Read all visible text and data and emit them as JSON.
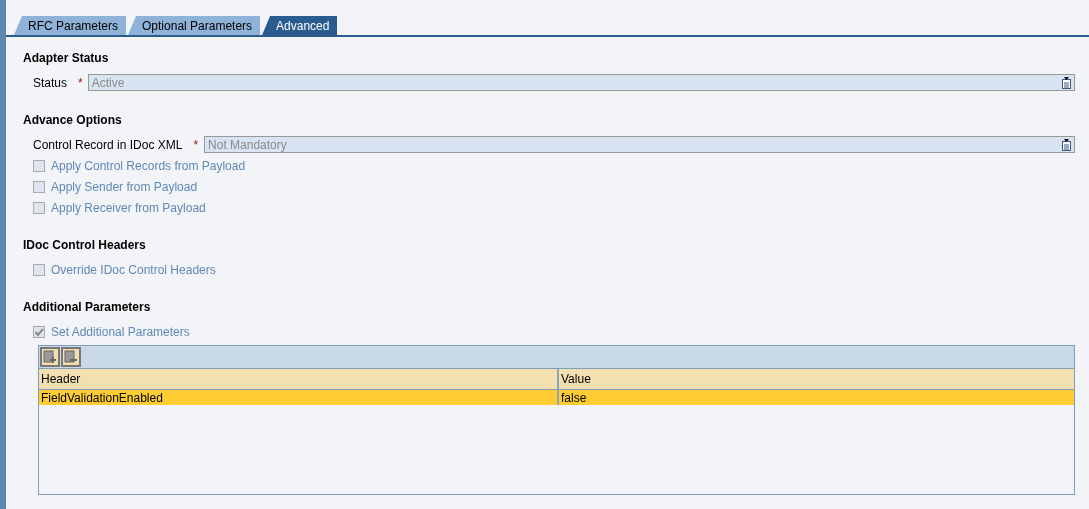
{
  "tabs": [
    {
      "label": "RFC Parameters",
      "selected": false
    },
    {
      "label": "Optional Parameters",
      "selected": false
    },
    {
      "label": "Advanced",
      "selected": true
    }
  ],
  "sections": [
    {
      "title": "Adapter Status",
      "items": [
        {
          "kind": "dropdown",
          "label": "Status",
          "required_mark": "*",
          "value": "Active",
          "disabled": true
        }
      ]
    },
    {
      "title": "Advance Options",
      "items": [
        {
          "kind": "dropdown",
          "label": "Control Record in IDoc XML",
          "required_mark": "*",
          "value": "Not Mandatory",
          "disabled": true
        },
        {
          "kind": "checkbox",
          "label": "Apply Control Records from Payload",
          "checked": false,
          "disabled": true
        },
        {
          "kind": "checkbox",
          "label": "Apply Sender from Payload",
          "checked": false,
          "disabled": true
        },
        {
          "kind": "checkbox",
          "label": "Apply Receiver from Payload",
          "checked": false,
          "disabled": true
        }
      ]
    },
    {
      "title": "IDoc Control Headers",
      "items": [
        {
          "kind": "checkbox",
          "label": "Override IDoc Control Headers",
          "checked": false,
          "disabled": true
        }
      ]
    },
    {
      "title": "Additional Parameters",
      "items": [
        {
          "kind": "checkbox",
          "label": "Set Additional Parameters",
          "checked": true,
          "disabled": true
        }
      ]
    }
  ],
  "table": {
    "columns": [
      "Header",
      "Value"
    ],
    "rows": [
      {
        "cells": [
          "FieldValidationEnabled",
          "false"
        ],
        "selected": true
      }
    ]
  }
}
